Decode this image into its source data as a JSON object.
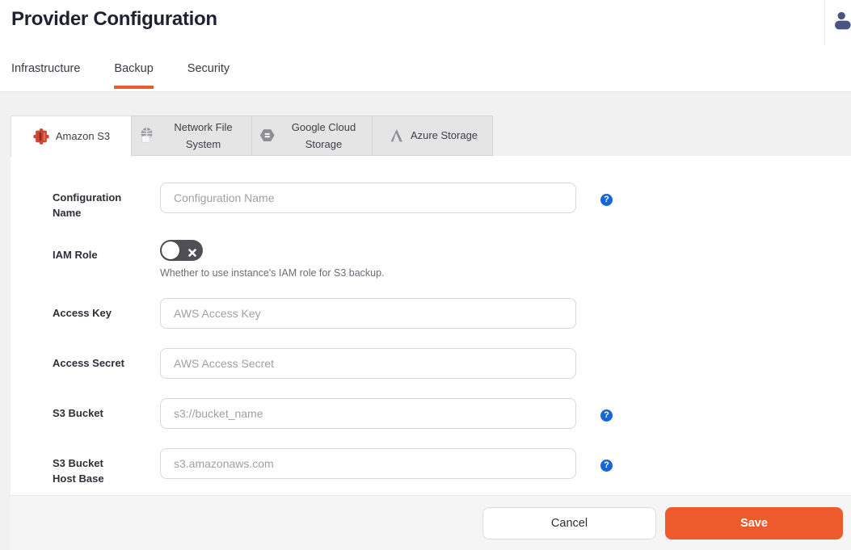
{
  "header": {
    "title": "Provider Configuration"
  },
  "nav": {
    "tabs": [
      {
        "label": "Infrastructure",
        "active": false
      },
      {
        "label": "Backup",
        "active": true
      },
      {
        "label": "Security",
        "active": false
      }
    ]
  },
  "provider_tabs": [
    {
      "label": "Amazon S3",
      "icon": "amazon-s3-bucket-icon",
      "active": true
    },
    {
      "label": "Network File System",
      "icon": "network-globe-file-icon",
      "active": false
    },
    {
      "label": "Google Cloud Storage",
      "icon": "gcs-hexagon-icon",
      "active": false
    },
    {
      "label": "Azure Storage",
      "icon": "azure-logo-icon",
      "active": false
    }
  ],
  "form": {
    "configuration_name": {
      "label": "Configuration Name",
      "placeholder": "Configuration Name",
      "value": "",
      "has_help": true
    },
    "iam_role": {
      "label": "IAM Role",
      "enabled": false,
      "helper": "Whether to use instance's IAM role for S3 backup."
    },
    "access_key": {
      "label": "Access Key",
      "placeholder": "AWS Access Key",
      "value": ""
    },
    "access_secret": {
      "label": "Access Secret",
      "placeholder": "AWS Access Secret",
      "value": ""
    },
    "s3_bucket": {
      "label": "S3 Bucket",
      "placeholder": "s3://bucket_name",
      "value": "",
      "has_help": true
    },
    "s3_bucket_host_base": {
      "label": "S3 Bucket Host Base",
      "placeholder": "s3.amazonaws.com",
      "value": "",
      "has_help": true
    }
  },
  "icons": {
    "help_glyph": "?"
  },
  "footer": {
    "cancel_label": "Cancel",
    "save_label": "Save"
  },
  "colors": {
    "accent_orange": "#ed5a2b",
    "help_blue": "#1766d8",
    "s3_red": "#cd4733",
    "user_icon_navy": "#4a5382",
    "page_gray": "#f1f1f2",
    "inactive_tab_gray": "#e5e5e6"
  }
}
